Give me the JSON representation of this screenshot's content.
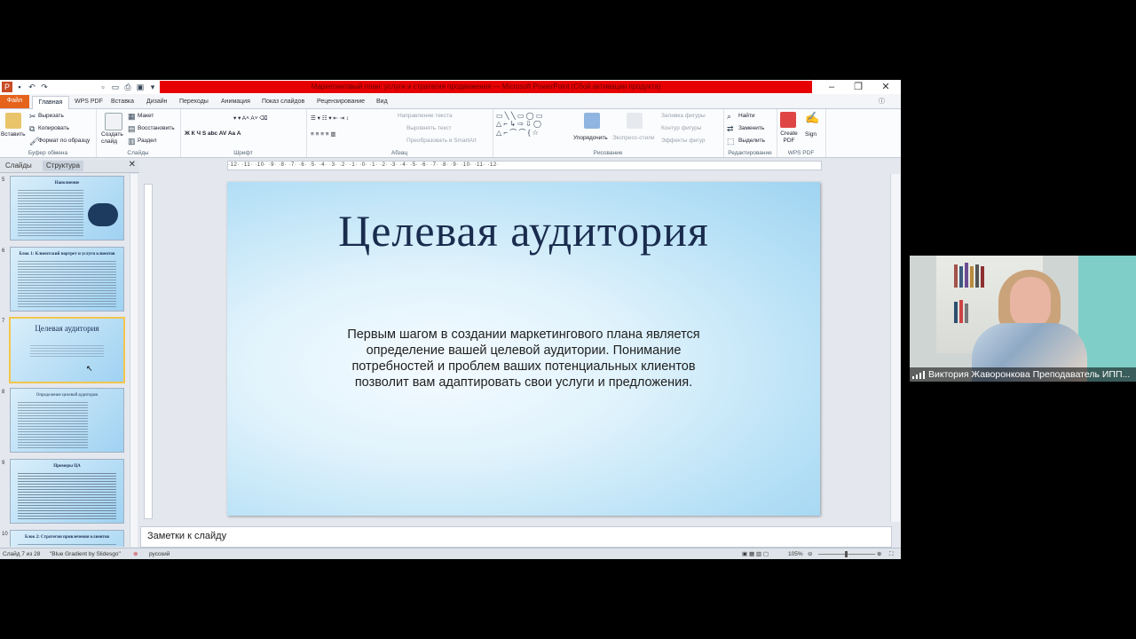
{
  "window": {
    "title": "Маркетинговый план: услуги и стратегия продвижения — Microsoft PowerPoint (Сбой активации продукта)"
  },
  "tabs": [
    "Файл",
    "Главная",
    "WPS PDF",
    "Вставка",
    "Дизайн",
    "Переходы",
    "Анимация",
    "Показ слайдов",
    "Рецензирование",
    "Вид"
  ],
  "ribbon": {
    "clipboard": {
      "paste": "Вставить",
      "cut": "Вырезать",
      "copy": "Копировать",
      "format": "Формат по образцу",
      "label": "Буфер обмена"
    },
    "slides": {
      "new": "Создать слайд",
      "layout": "Макет",
      "reset": "Восстановить",
      "section": "Раздел",
      "label": "Слайды"
    },
    "font": {
      "label": "Шрифт"
    },
    "paragraph": {
      "direction": "Направление текста",
      "align": "Выровнять текст",
      "smartart": "Преобразовать в SmartArt",
      "label": "Абзац"
    },
    "drawing": {
      "arrange": "Упорядочить",
      "styles": "Экспресс-стили",
      "fill": "Заливка фигуры",
      "outline": "Контур фигуры",
      "effects": "Эффекты фигур",
      "label": "Рисование"
    },
    "editing": {
      "find": "Найти",
      "replace": "Заменить",
      "select": "Выделить",
      "label": "Редактирование"
    },
    "wpspdf": {
      "create": "Create PDF",
      "sign": "Sign",
      "label": "WPS PDF"
    }
  },
  "left_pane": {
    "tab_slides": "Слайды",
    "tab_outline": "Структура",
    "thumbnails": [
      {
        "num": "5",
        "title": "Наполнение"
      },
      {
        "num": "6",
        "title": "Блок 1: Клиентский портрет и услуги клиентов"
      },
      {
        "num": "7",
        "title": "Целевая аудитория",
        "selected": true
      },
      {
        "num": "8",
        "title": "Определение целевой аудитории"
      },
      {
        "num": "9",
        "title": "Примеры ЦА"
      },
      {
        "num": "10",
        "title": "Блок 2: Стратегия привлечения клиентов"
      }
    ]
  },
  "ruler_text": "·12· ·11· ·10· ·9· ·8· ·7· ·6· ·5· ·4· ·3· ·2· ·1· ·0· ·1· ·2· ·3· ·4· ·5· ·6· ·7· ·8· ·9· ·10· ·11· ·12·",
  "slide": {
    "title": "Целевая аудитория",
    "body": "Первым шагом в создании маркетингового плана является определение вашей целевой аудитории. Понимание потребностей и проблем ваших потенциальных клиентов позволит вам адаптировать свои услуги и предложения."
  },
  "notes": {
    "placeholder": "Заметки к слайду"
  },
  "status": {
    "slide_of": "Слайд 7 из 28",
    "theme": "\"Blue Gradient by Slidesgo\"",
    "language": "русский",
    "zoom": "105%"
  },
  "webcam": {
    "name": "Виктория Жаворонкова Преподаватель ИПП..."
  },
  "colors": {
    "file_tab": "#e6631c",
    "title_highlight": "#e60000",
    "slide_title": "#1a2c4e",
    "selected_thumb_border": "#f2c64d"
  }
}
